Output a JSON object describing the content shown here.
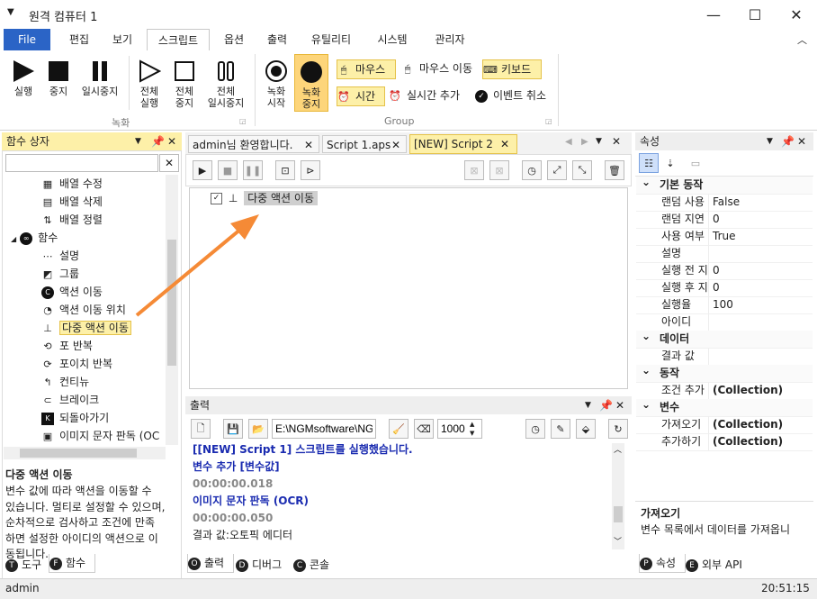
{
  "window": {
    "title": "원격 컴퓨터 1",
    "minimize": "—",
    "maximize": "☐",
    "close": "✕"
  },
  "menu": {
    "file": "File",
    "items": [
      "편집",
      "보기",
      "스크립트",
      "옵션",
      "출력",
      "유틸리티",
      "시스템",
      "관리자"
    ]
  },
  "ribbon": {
    "record": {
      "label": "녹화",
      "buttons": [
        {
          "l1": "실행",
          "l2": ""
        },
        {
          "l1": "중지",
          "l2": ""
        },
        {
          "l1": "일시중지",
          "l2": ""
        },
        {
          "l1": "전체",
          "l2": "실행"
        },
        {
          "l1": "전체",
          "l2": "중지"
        },
        {
          "l1": "전체",
          "l2": "일시중지"
        }
      ]
    },
    "group": {
      "label": "Group",
      "record_start": [
        "녹화",
        "시작"
      ],
      "record_stop": [
        "녹화",
        "중지"
      ],
      "mouse": "마우스",
      "mouse_move": "마우스 이동",
      "keyboard": "키보드",
      "time": "시간",
      "realtime_add": "실시간 추가",
      "event_cancel": "이벤트 취소"
    }
  },
  "function_box": {
    "title": "함수 상자",
    "search_value": "",
    "items": [
      "배열 수정",
      "배열 삭제",
      "배열 정렬",
      "함수",
      "설명",
      "그룹",
      "액션 이동",
      "액션 이동 위치",
      "다중 액션 이동",
      "포 반복",
      "포이치 반복",
      "컨티뉴",
      "브레이크",
      "되돌아가기",
      "이미지 문자 판독 (OC"
    ],
    "desc_title": "다중 액션 이동",
    "desc": [
      "변수 값에 따라 액션을 이동할 수",
      "있습니다. 멀티로 설정할 수 있으며,",
      "순차적으로 검사하고 조건에 만족",
      "하면 설정한 아이디의 액션으로 이",
      "동됩니다."
    ],
    "tabs": {
      "tool": "도구",
      "func": "함수",
      "tool_badge": "T",
      "func_badge": "F"
    }
  },
  "doc_tabs": [
    "admin님 환영합니다.",
    "Script 1.aps",
    "[NEW] Script 2"
  ],
  "script": {
    "node": "다중 액션 이동"
  },
  "output": {
    "title": "출력",
    "path": "E:\\NGMsoftware\\NG",
    "count": "1000",
    "lines": [
      {
        "text": "[[NEW] Script 1] 스크립트를 실행했습니다.",
        "color": "#1a2bb0",
        "bold": true
      },
      {
        "text": "변수 추가 [변수값]",
        "color": "#1a2bb0",
        "bold": true
      },
      {
        "text": "00:00:00.018",
        "color": "#888",
        "bold": true
      },
      {
        "text": "이미지 문자 판독 (OCR)",
        "color": "#1a2bb0",
        "bold": true
      },
      {
        "text": "00:00:00.050",
        "color": "#888",
        "bold": true
      },
      {
        "text": "결과 값:오토픽 에디터",
        "color": "#222",
        "bold": false
      }
    ],
    "tabs": {
      "output": "출력",
      "debug": "디버그",
      "console": "콘솔",
      "output_badge": "O",
      "debug_badge": "D",
      "console_badge": "C"
    }
  },
  "properties": {
    "title": "속성",
    "rows": [
      {
        "cat": true,
        "k": "기본 동작"
      },
      {
        "k": "랜덤 사용",
        "v": "False"
      },
      {
        "k": "랜덤 지연",
        "v": "0"
      },
      {
        "k": "사용 여부",
        "v": "True"
      },
      {
        "k": "설명",
        "v": ""
      },
      {
        "k": "실행 전 지",
        "v": "0"
      },
      {
        "k": "실행 후 지",
        "v": "0"
      },
      {
        "k": "실행율",
        "v": "100"
      },
      {
        "k": "아이디",
        "v": ""
      },
      {
        "cat": true,
        "k": "데이터"
      },
      {
        "k": "결과 값",
        "v": ""
      },
      {
        "cat": true,
        "k": "동작"
      },
      {
        "k": "조건 추가",
        "v": "(Collection)"
      },
      {
        "cat": true,
        "k": "변수"
      },
      {
        "k": "가져오기",
        "v": "(Collection)"
      },
      {
        "k": "추가하기",
        "v": "(Collection)"
      }
    ],
    "desc_title": "가져오기",
    "desc": "변수 목록에서 데이터를 가져옵니",
    "tabs": {
      "prop": "속성",
      "api": "외부 API",
      "prop_badge": "P",
      "api_badge": "E"
    }
  },
  "status": {
    "user": "admin",
    "time": "20:51:15"
  },
  "colors": {
    "accent": "#2b64c6",
    "highlight": "#fdf0a8",
    "arrow": "#f58a36"
  }
}
